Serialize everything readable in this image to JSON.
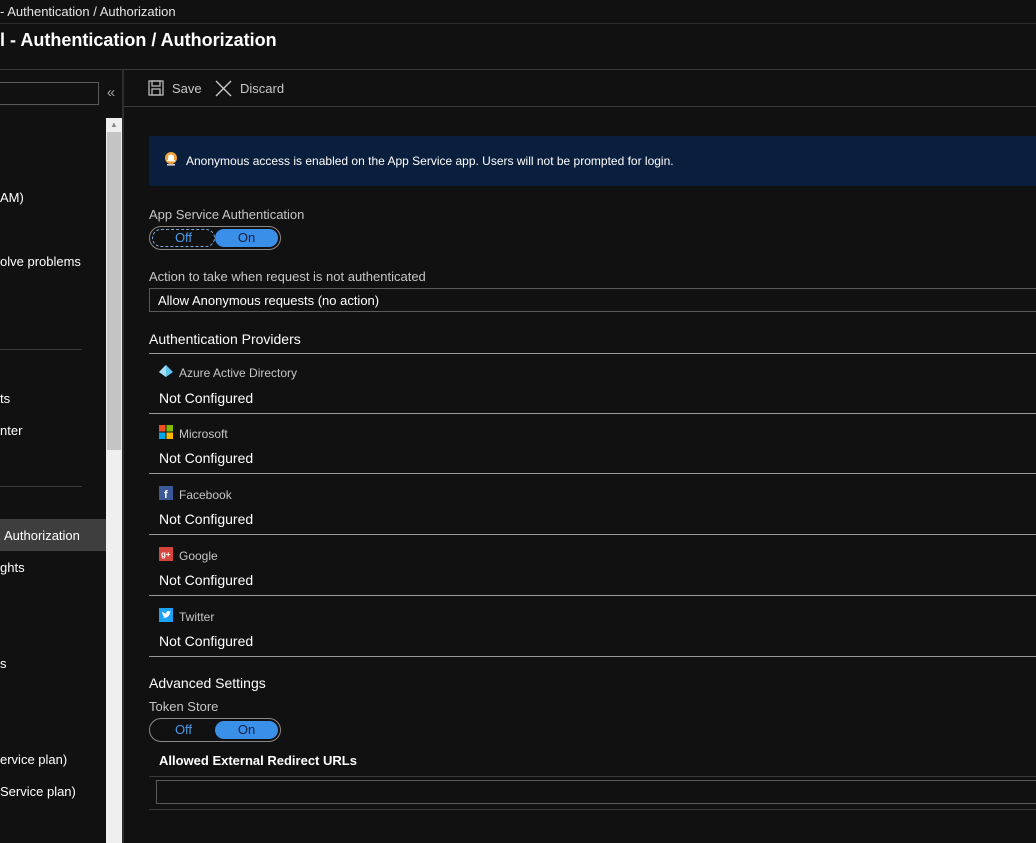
{
  "breadcrumb": "- Authentication / Authorization",
  "page_title": "l - Authentication / Authorization",
  "leftnav": {
    "search_placeholder": "",
    "collapse_glyph": "«",
    "items": [
      {
        "label": "AM)"
      },
      {
        "label": "olve problems"
      },
      {
        "label": "ts"
      },
      {
        "label": "nter"
      },
      {
        "label": "Authorization"
      },
      {
        "label": "ghts"
      },
      {
        "label": "s"
      },
      {
        "label": "ervice plan)"
      },
      {
        "label": "Service plan)"
      }
    ]
  },
  "toolbar": {
    "save_label": "Save",
    "discard_label": "Discard",
    "save_icon": "save-icon",
    "discard_icon": "close-icon"
  },
  "banner": {
    "icon": "bell-icon",
    "message": "Anonymous access is enabled on the App Service app. Users will not be prompted for login."
  },
  "app_service_auth": {
    "label": "App Service Authentication",
    "off_label": "Off",
    "on_label": "On",
    "selected": "On"
  },
  "action": {
    "label": "Action to take when request is not authenticated",
    "selected": "Allow Anonymous requests (no action)"
  },
  "providers": {
    "title": "Authentication Providers",
    "items": [
      {
        "name": "Azure Active Directory",
        "status": "Not Configured",
        "icon": "azure-ad-icon"
      },
      {
        "name": "Microsoft",
        "status": "Not Configured",
        "icon": "microsoft-icon"
      },
      {
        "name": "Facebook",
        "status": "Not Configured",
        "icon": "facebook-icon"
      },
      {
        "name": "Google",
        "status": "Not Configured",
        "icon": "google-icon"
      },
      {
        "name": "Twitter",
        "status": "Not Configured",
        "icon": "twitter-icon"
      }
    ]
  },
  "advanced": {
    "title": "Advanced Settings",
    "token_store_label": "Token Store",
    "off_label": "Off",
    "on_label": "On",
    "selected": "On",
    "urls_label": "Allowed External Redirect URLs",
    "urls_value": ""
  },
  "colors": {
    "banner_bg": "#0a1f3d",
    "accent": "#3a8fe8",
    "active_nav": "#3e3e3e"
  }
}
